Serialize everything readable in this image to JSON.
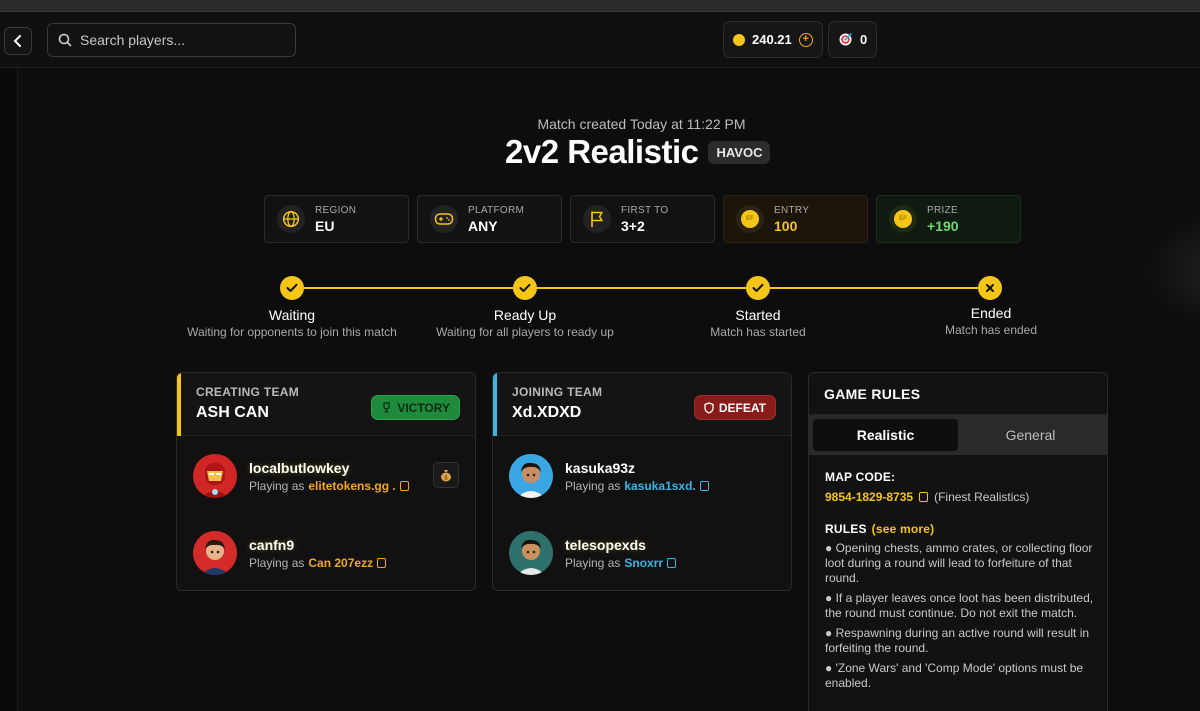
{
  "header": {
    "search_placeholder": "Search players...",
    "balance": "240.21",
    "tickets": "0"
  },
  "match": {
    "created": "Match created Today at 11:22 PM",
    "title": "2v2 Realistic",
    "tag": "HAVOC"
  },
  "info": [
    {
      "label": "REGION",
      "value": "EU",
      "icon": "globe-icon"
    },
    {
      "label": "PLATFORM",
      "value": "ANY",
      "icon": "gamepad-icon"
    },
    {
      "label": "FIRST TO",
      "value": "3+2",
      "icon": "flag-icon"
    },
    {
      "label": "ENTRY",
      "value": "100",
      "icon": "coin-icon"
    },
    {
      "label": "PRIZE",
      "value": "+190",
      "icon": "coin-icon"
    }
  ],
  "steps": [
    {
      "title": "Waiting",
      "desc": "Waiting for opponents to join this match",
      "state": "done"
    },
    {
      "title": "Ready Up",
      "desc": "Waiting for all players to ready up",
      "state": "done"
    },
    {
      "title": "Started",
      "desc": "Match has started",
      "state": "done"
    },
    {
      "title": "Ended",
      "desc": "Match has ended",
      "state": "ended"
    }
  ],
  "teams": [
    {
      "label": "CREATING TEAM",
      "name": "ASH CAN",
      "result": "VICTORY",
      "players": [
        {
          "name": "localbutlowkey",
          "playing_as_label": "Playing as",
          "playing_as": "elitetokens.gg ."
        },
        {
          "name": "canfn9",
          "playing_as_label": "Playing as",
          "playing_as": "Can 207ezz"
        }
      ]
    },
    {
      "label": "JOINING TEAM",
      "name": "Xd.XDXD",
      "result": "DEFEAT",
      "players": [
        {
          "name": "kasuka93z",
          "playing_as_label": "Playing as",
          "playing_as": "kasuka1sxd."
        },
        {
          "name": "telesopexds",
          "playing_as_label": "Playing as",
          "playing_as": "Snoxrr"
        }
      ]
    }
  ],
  "rules": {
    "title": "GAME RULES",
    "tabs": [
      "Realistic",
      "General"
    ],
    "active_tab": "Realistic",
    "map_code_label": "MAP CODE:",
    "map_code": "9854-1829-8735",
    "map_note": "(Finest Realistics)",
    "rules_label": "RULES",
    "see_more": "(see more)",
    "items": [
      "● Opening chests, ammo crates, or collecting floor loot during a round will lead to forfeiture of that round.",
      "● If a player leaves once loot has been distributed, the round must continue. Do not exit the match.",
      "● Respawning during an active round will result in forfeiting the round.",
      "● 'Zone Wars' and 'Comp Mode' options must be enabled."
    ]
  },
  "colors": {
    "accent_gold": "#f5c518",
    "victory_green": "#1e8a3c",
    "defeat_red": "#8a1b1b",
    "joining_team_blue": "#38b6e8"
  }
}
